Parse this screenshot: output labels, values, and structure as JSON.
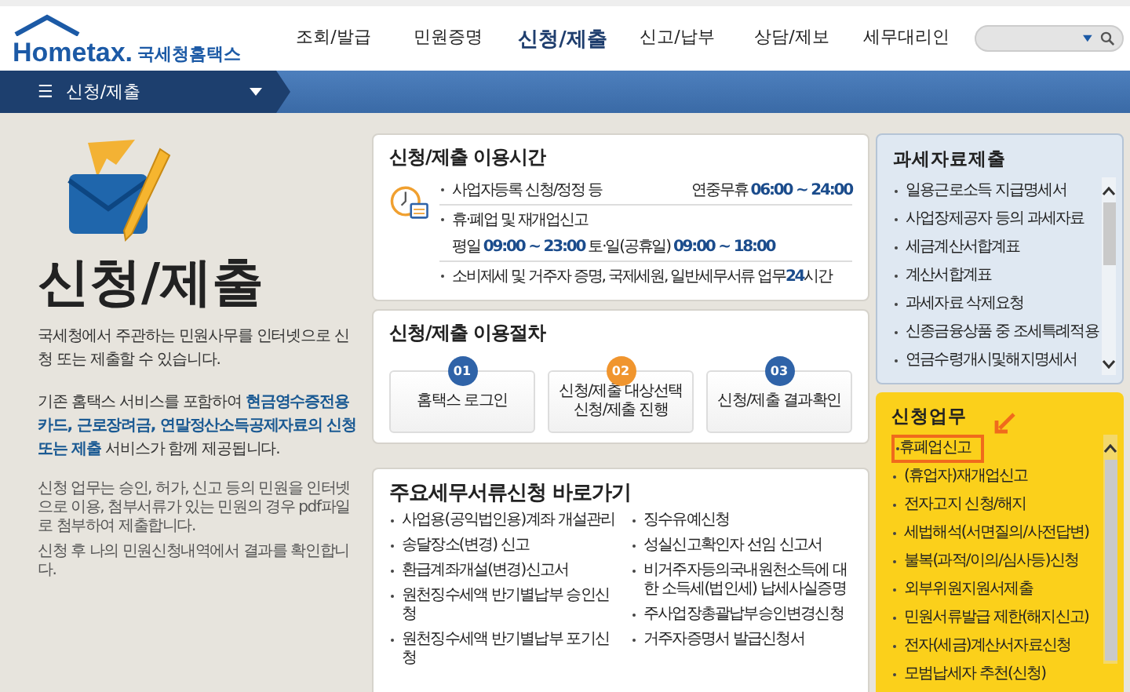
{
  "header": {
    "logo": "Hometax.",
    "logo_sub": "국세청홈택스",
    "nav": [
      {
        "label": "조회/발급",
        "selected": false
      },
      {
        "label": "민원증명",
        "selected": false
      },
      {
        "label": "신청/제출",
        "selected": true
      },
      {
        "label": "신고/납부",
        "selected": false
      },
      {
        "label": "상담/제보",
        "selected": false
      },
      {
        "label": "세무대리인",
        "selected": false
      }
    ]
  },
  "breadcrumb": {
    "menu_icon": "☰",
    "label": "신청/제출"
  },
  "intro": {
    "title": "신청/제출",
    "text": "국세청에서 주관하는 민원사무를 인터넷으로 신청 또는 제출할 수 있습니다.",
    "text2": "기존 홈택스 서비스를 포함하여 **현금영수증전용카드, 근로장려금, 연말정산소득공제자료의 신청 또는 제출** 서비스가 함께 제공됩니다.",
    "notes": [
      "신청 업무는 승인, 허가, 신고 등의 민원을 인터넷으로 이용, 첨부서류가 있는 민원의 경우 pdf파일로 첨부하여 제출합니다.",
      "신청 후 나의 민원신청내역에서 결과를 확인합니다."
    ]
  },
  "hours": {
    "title": "신청/제출 이용시간",
    "rows": [
      {
        "text": "사업자등록 신청/정정 등",
        "extra": "연중무휴 **06:00 ~ 24:00**"
      },
      {
        "text": "휴·폐업 및 재개업신고",
        "extra": "평일 **09:00 ~ 23:00** 토·일(공휴일) **09:00 ~ 18:00**"
      },
      {
        "text": "소비제세 및 거주자 증명, 국제세원, 일반세무서류 업무**24**시간"
      }
    ]
  },
  "procedure": {
    "title": "신청/제출 이용절차",
    "steps": [
      {
        "number": "01",
        "color": "#2f63a8",
        "label": "홈택스 로그인"
      },
      {
        "number": "02",
        "color": "#f0952e",
        "label": "신청/제출 대상선택 신청/제출 진행"
      },
      {
        "number": "03",
        "color": "#2f63a8",
        "label": "신청/제출 결과확인"
      }
    ]
  },
  "shortcuts": {
    "title": "주요세무서류신청 바로가기",
    "columns": [
      [
        "사업용(공익법인용)계좌 개설관리",
        "송달장소(변경) 신고",
        "환급계좌개설(변경)신고서",
        "원천징수세액 반기별납부 승인신청",
        "원천징수세액 반기별납부 포기신청"
      ],
      [
        "징수유예신청",
        "성실신고확인자 선임 신고서",
        "비거주자등의국내원천소득에 대한 소득세(법인세) 납세사실증명",
        "주사업장총괄납부승인변경신청",
        "거주자증명서 발급신청서"
      ]
    ]
  },
  "data_submit": {
    "title": "과세자료제출",
    "items": [
      "일용근로소득 지급명세서",
      "사업장제공자 등의 과세자료",
      "세금계산서합계표",
      "계산서합계표",
      "과세자료 삭제요청",
      "신종금융상품 중 조세특례적용",
      "연금수령개시및해지명세서"
    ]
  },
  "apply_tasks": {
    "title": "신청업무",
    "items": [
      {
        "label": "휴폐업신고",
        "selected": true
      },
      {
        "label": "(휴업자)재개업신고",
        "selected": false
      },
      {
        "label": "전자고지 신청/해지",
        "selected": false
      },
      {
        "label": "세법해석(서면질의/사전답변)",
        "selected": false
      },
      {
        "label": "불복(과적/이의/심사등)신청",
        "selected": false
      },
      {
        "label": "외부위원지원서제출",
        "selected": false
      },
      {
        "label": "민원서류발급 제한(해지신고)",
        "selected": false
      },
      {
        "label": "전자(세금)계산서자료신청",
        "selected": false
      },
      {
        "label": "모범납세자 추천(신청)",
        "selected": false
      }
    ]
  }
}
